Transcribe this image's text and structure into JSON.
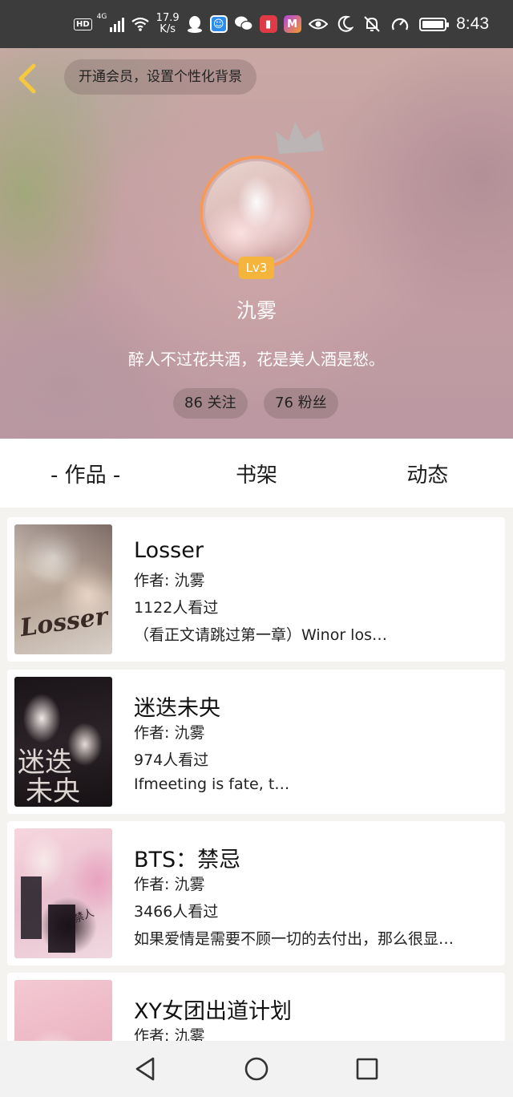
{
  "status_bar": {
    "hd": "HD",
    "network": "4G",
    "speed_value": "17.9",
    "speed_unit": "K/s",
    "time": "8:43",
    "app_icons": [
      "qq-icon",
      "assistant-icon",
      "wechat-icon",
      "reader-icon",
      "m-app-icon"
    ],
    "status_icons": [
      "eye-icon",
      "moon-icon",
      "bell-off-icon",
      "nfc-icon",
      "battery-icon"
    ]
  },
  "header": {
    "vip_banner": "开通会员，设置个性化背景",
    "level": "Lv3",
    "nickname": "氿雾",
    "bio": "醉人不过花共酒，花是美人酒是愁。",
    "follow": "86 关注",
    "fans": "76 粉丝",
    "accent_color": "#f59a5a",
    "badge_color": "#f5b43c"
  },
  "tabs": [
    {
      "label": "- 作品 -",
      "active": true
    },
    {
      "label": "书架",
      "active": false
    },
    {
      "label": "动态",
      "active": false
    }
  ],
  "books": [
    {
      "title": "Losser",
      "author": "作者: 氿雾",
      "views": "1122人看过",
      "desc": "（看正文请跳过第一章）Winor los…"
    },
    {
      "title": "迷迭未央",
      "author": "作者: 氿雾",
      "views": "974人看过",
      "desc": "Ifmeeting is fate, t…"
    },
    {
      "title": "BTS：禁忌",
      "author": "作者: 氿雾",
      "views": "3466人看过",
      "desc": "如果爱情是需要不顾一切的去付出，那么很显…"
    },
    {
      "title": "XY女团出道计划",
      "author": "作者: 氿雾",
      "views": "",
      "desc": ""
    }
  ],
  "nav": {
    "back": "back-triangle-icon",
    "home": "home-circle-icon",
    "recents": "recents-square-icon"
  }
}
